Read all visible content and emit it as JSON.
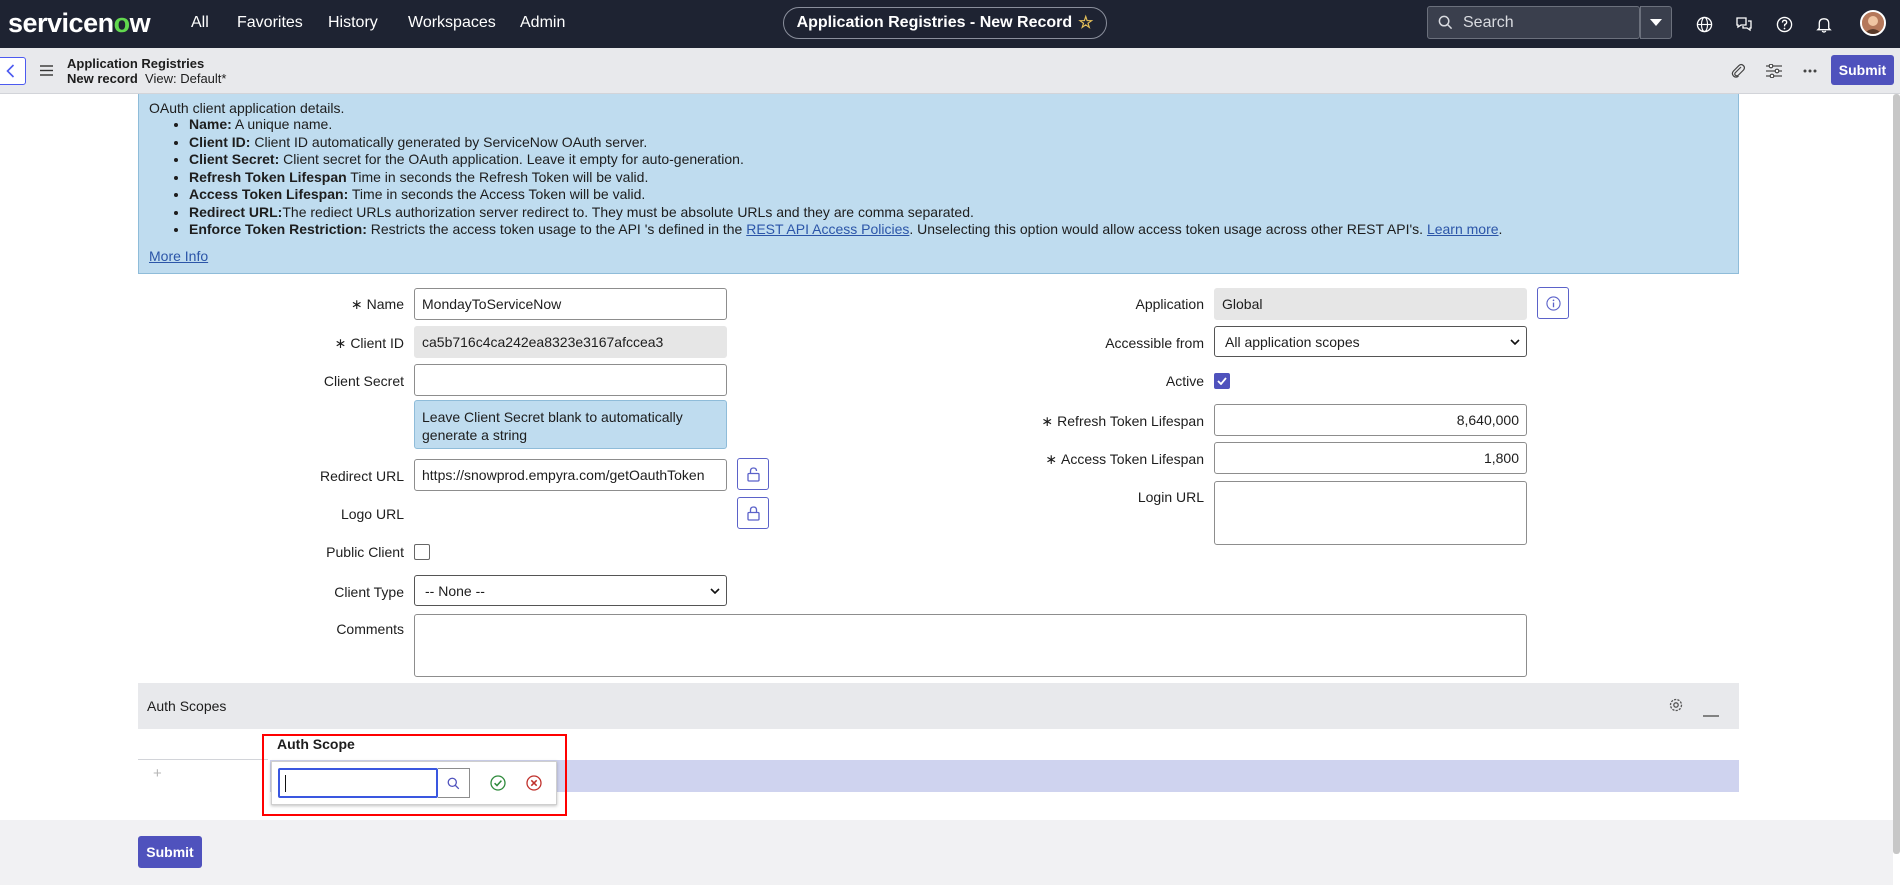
{
  "topnav": {
    "logo": "servicenow",
    "links": [
      "All",
      "Favorites",
      "History",
      "Workspaces",
      "Admin"
    ],
    "title": "Application Registries - New Record",
    "search_placeholder": "Search"
  },
  "header": {
    "title": "Application Registries",
    "record": "New record",
    "view": "View: Default*",
    "submit_label": "Submit"
  },
  "info": {
    "intro": "OAuth client application details.",
    "items": [
      {
        "term": "Name:",
        "text": " A unique name."
      },
      {
        "term": "Client ID:",
        "text": " Client ID automatically generated by ServiceNow OAuth server."
      },
      {
        "term": "Client Secret:",
        "text": " Client secret for the OAuth application. Leave it empty for auto-generation."
      },
      {
        "term": "Refresh Token Lifespan",
        "text": " Time in seconds the Refresh Token will be valid."
      },
      {
        "term": "Access Token Lifespan:",
        "text": " Time in seconds the Access Token will be valid."
      },
      {
        "term": "Redirect URL:",
        "text": "The rediect URLs authorization server redirect to. They must be absolute URLs and they are comma separated."
      }
    ],
    "enforce_term": "Enforce Token Restriction:",
    "enforce_text1": " Restricts the access token usage to the API 's defined in the ",
    "enforce_link1": "REST API Access Policies",
    "enforce_text2": ". Unselecting this option would allow access token usage across other REST API's. ",
    "enforce_link2": "Learn more",
    "enforce_text3": ".",
    "more_info": "More Info"
  },
  "form": {
    "name_label": "Name",
    "name_value": "MondayToServiceNow",
    "client_id_label": "Client ID",
    "client_id_value": "ca5b716c4ca242ea8323e3167afccea3",
    "client_secret_label": "Client Secret",
    "client_secret_value": "",
    "client_secret_hint": "Leave Client Secret blank to automatically generate a string",
    "redirect_label": "Redirect URL",
    "redirect_value": "https://snowprod.empyra.com/getOauthToken",
    "logo_label": "Logo URL",
    "public_client_label": "Public Client",
    "public_client_checked": false,
    "client_type_label": "Client Type",
    "client_type_value": "-- None --",
    "comments_label": "Comments",
    "application_label": "Application",
    "application_value": "Global",
    "accessible_label": "Accessible from",
    "accessible_value": "All application scopes",
    "active_label": "Active",
    "active_checked": true,
    "refresh_label": "Refresh Token Lifespan",
    "refresh_value": "8,640,000",
    "access_label": "Access Token Lifespan",
    "access_value": "1,800",
    "login_label": "Login URL"
  },
  "related": {
    "title": "Auth Scopes",
    "column": "Auth Scope",
    "add_glyph": "+"
  },
  "footer": {
    "submit_label": "Submit"
  },
  "colors": {
    "nav_bg": "#1e2332",
    "accent": "#4f52bd",
    "info_bg": "#bfdcef",
    "highlight": "#ff0000"
  }
}
